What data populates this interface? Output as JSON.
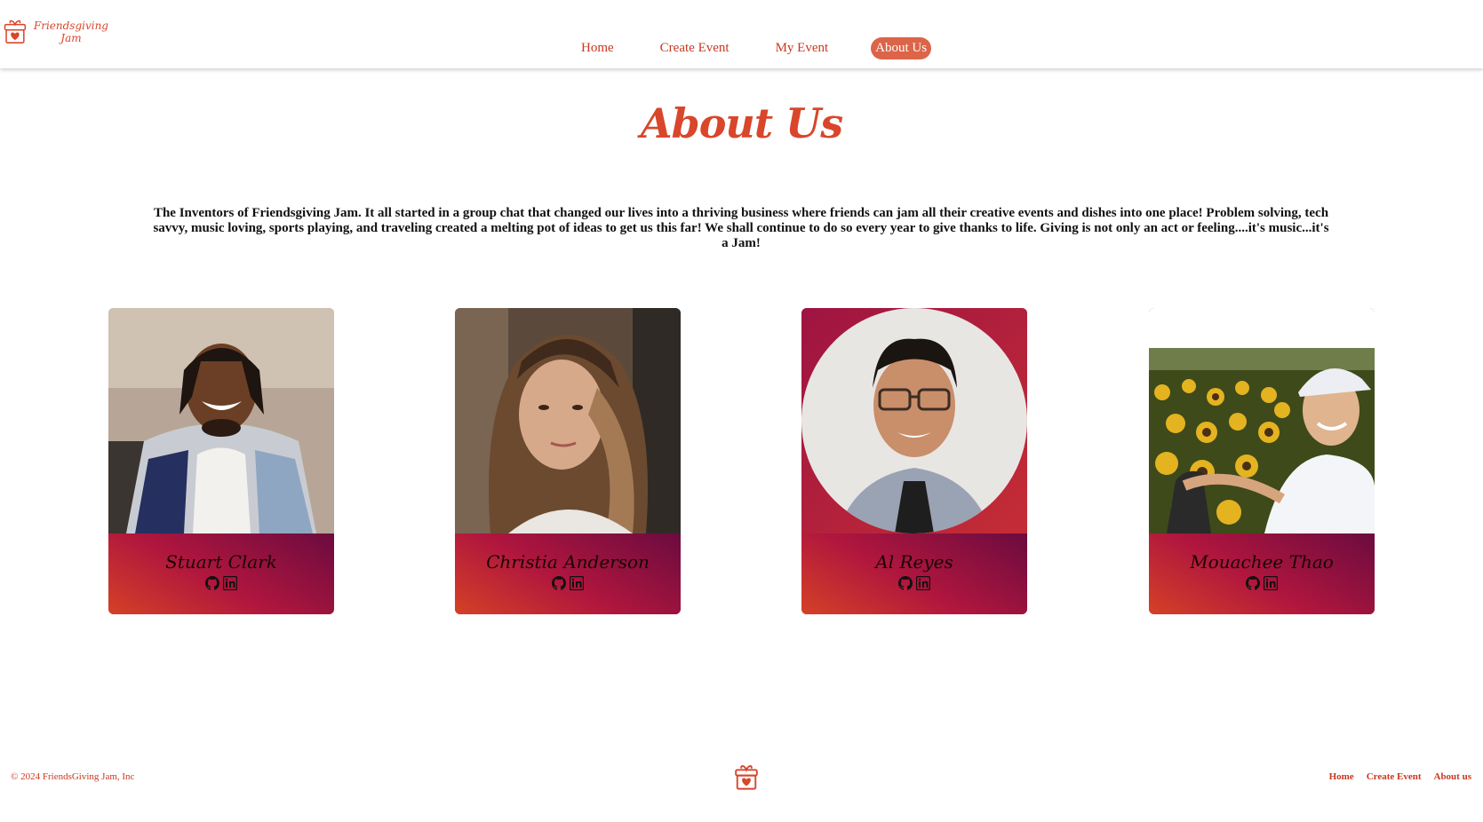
{
  "brand": {
    "name_line1": "Friendsgiving",
    "name_line2": "Jam",
    "accent_color": "#d9462b"
  },
  "nav": {
    "items": [
      {
        "label": "Home"
      },
      {
        "label": "Create Event"
      },
      {
        "label": "My Event"
      },
      {
        "label": "About Us",
        "active": true
      }
    ]
  },
  "page": {
    "title": "About Us",
    "intro": "The Inventors of Friendsgiving Jam. It all started in a group chat that changed our lives into a thriving business where friends can jam all their creative events and dishes into one place! Problem solving, tech savvy, music loving, sports playing, and traveling created a melting pot of ideas to get us this far! We shall continue to do so every year to give thanks to life. Giving is not only an act or feeling....it's music...it's a Jam!"
  },
  "team": [
    {
      "name": "Stuart Clark",
      "icons": [
        "github-icon",
        "linkedin-icon"
      ]
    },
    {
      "name": "Christia Anderson",
      "icons": [
        "github-icon",
        "linkedin-icon"
      ]
    },
    {
      "name": "Al Reyes",
      "icons": [
        "github-icon",
        "linkedin-icon"
      ]
    },
    {
      "name": "Mouachee Thao",
      "icons": [
        "github-icon",
        "linkedin-icon"
      ]
    }
  ],
  "footer": {
    "copyright": "© 2024 FriendsGiving Jam, Inc",
    "links": [
      {
        "label": "Home"
      },
      {
        "label": "Create Event"
      },
      {
        "label": "About us"
      }
    ]
  }
}
